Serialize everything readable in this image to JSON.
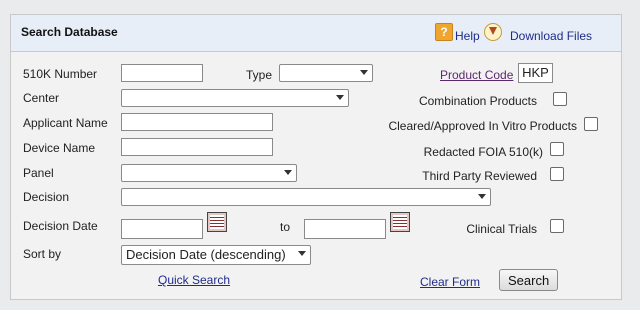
{
  "header": {
    "title": "Search Database",
    "help_label": "Help",
    "download_label": "Download Files",
    "help_icon": "help-icon",
    "download_icon": "download-icon"
  },
  "left_fields": {
    "k510_label": "510K Number",
    "type_label": "Type",
    "center_label": "Center",
    "applicant_label": "Applicant Name",
    "device_label": "Device Name",
    "panel_label": "Panel",
    "decision_label": "Decision",
    "decision_date_label": "Decision Date",
    "to_label": "to",
    "sort_label": "Sort by",
    "sort_value": "Decision Date (descending)"
  },
  "right_fields": {
    "product_code_label": "Product Code",
    "product_code_value": "HKP",
    "combination_label": "Combination Products",
    "cleared_label": "Cleared/Approved In Vitro Products",
    "redacted_label": "Redacted FOIA 510(k)",
    "third_party_label": "Third Party Reviewed",
    "clinical_label": "Clinical Trials"
  },
  "footer": {
    "quick_search_label": "Quick Search",
    "clear_form_label": "Clear Form",
    "search_button_label": "Search"
  },
  "colors": {
    "link": "#1f2c8a",
    "visited_link": "#5b2a6d",
    "header_bg": "#e7eef7"
  }
}
